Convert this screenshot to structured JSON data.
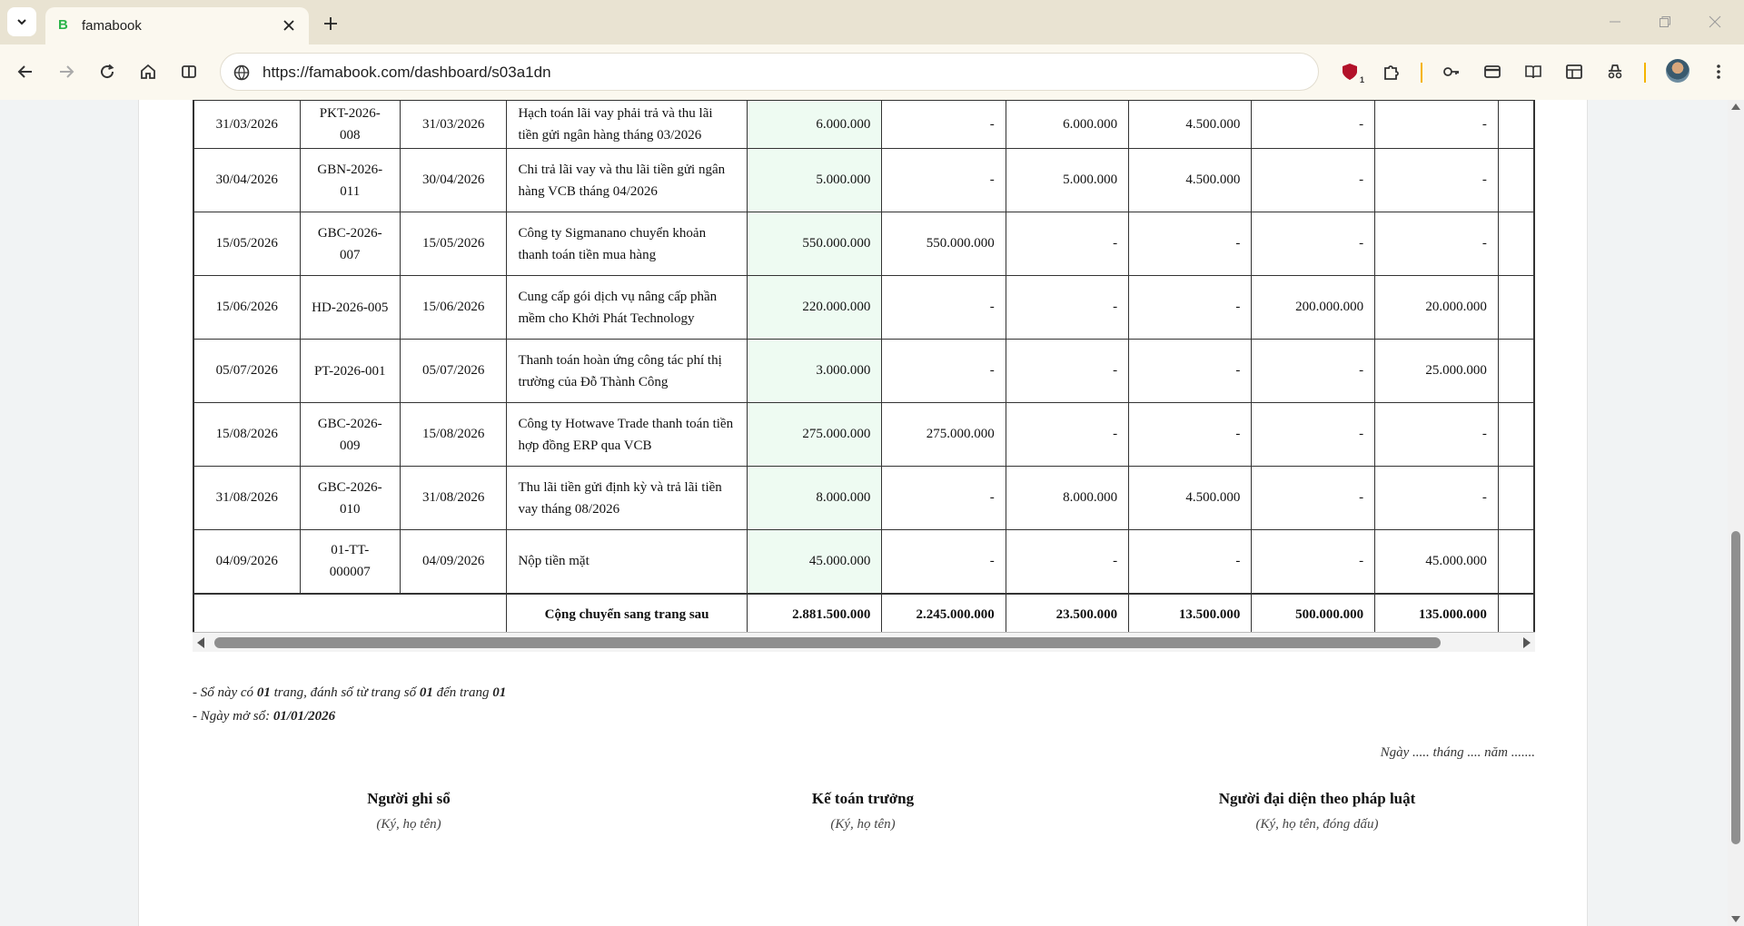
{
  "browser": {
    "tab_title": "famabook",
    "tab_favicon_letter": "B",
    "url": "https://famabook.com/dashboard/s03a1dn",
    "extension_badge": "1",
    "accent_color": "#f5b400"
  },
  "ledger": {
    "rows": [
      {
        "date": "31/03/2026",
        "doc_no": "PKT-2026-008",
        "doc_date": "31/03/2026",
        "desc": "Hạch toán lãi vay phải trả và thu lãi tiền gửi ngân hàng tháng 03/2026",
        "total": "6.000.000",
        "c1": "-",
        "c2": "6.000.000",
        "c3": "4.500.000",
        "c4": "-",
        "c5": "-"
      },
      {
        "date": "30/04/2026",
        "doc_no": "GBN-2026-011",
        "doc_date": "30/04/2026",
        "desc": "Chi trả lãi vay và thu lãi tiền gửi ngân hàng VCB tháng 04/2026",
        "total": "5.000.000",
        "c1": "-",
        "c2": "5.000.000",
        "c3": "4.500.000",
        "c4": "-",
        "c5": "-"
      },
      {
        "date": "15/05/2026",
        "doc_no": "GBC-2026-007",
        "doc_date": "15/05/2026",
        "desc": "Công ty Sigmanano chuyển khoản thanh toán tiền mua hàng",
        "total": "550.000.000",
        "c1": "550.000.000",
        "c2": "-",
        "c3": "-",
        "c4": "-",
        "c5": "-"
      },
      {
        "date": "15/06/2026",
        "doc_no": "HD-2026-005",
        "doc_date": "15/06/2026",
        "desc": "Cung cấp gói dịch vụ nâng cấp phần mềm cho Khởi Phát Technology",
        "total": "220.000.000",
        "c1": "-",
        "c2": "-",
        "c3": "-",
        "c4": "200.000.000",
        "c5": "20.000.000"
      },
      {
        "date": "05/07/2026",
        "doc_no": "PT-2026-001",
        "doc_date": "05/07/2026",
        "desc": "Thanh toán hoàn ứng công tác phí thị trường của Đỗ Thành Công",
        "total": "3.000.000",
        "c1": "-",
        "c2": "-",
        "c3": "-",
        "c4": "-",
        "c5": "25.000.000"
      },
      {
        "date": "15/08/2026",
        "doc_no": "GBC-2026-009",
        "doc_date": "15/08/2026",
        "desc": "Công ty Hotwave Trade thanh toán tiền hợp đồng ERP qua VCB",
        "total": "275.000.000",
        "c1": "275.000.000",
        "c2": "-",
        "c3": "-",
        "c4": "-",
        "c5": "-"
      },
      {
        "date": "31/08/2026",
        "doc_no": "GBC-2026-010",
        "doc_date": "31/08/2026",
        "desc": "Thu lãi tiền gửi định kỳ và trả lãi tiền vay tháng 08/2026",
        "total": "8.000.000",
        "c1": "-",
        "c2": "8.000.000",
        "c3": "4.500.000",
        "c4": "-",
        "c5": "-"
      },
      {
        "date": "04/09/2026",
        "doc_no": "01-TT-000007",
        "doc_date": "04/09/2026",
        "desc": "Nộp tiền mặt",
        "total": "45.000.000",
        "c1": "-",
        "c2": "-",
        "c3": "-",
        "c4": "-",
        "c5": "45.000.000"
      }
    ],
    "footer": {
      "label": "Cộng chuyển sang trang sau",
      "total": "2.881.500.000",
      "c1": "2.245.000.000",
      "c2": "23.500.000",
      "c3": "13.500.000",
      "c4": "500.000.000",
      "c5": "135.000.000"
    }
  },
  "notes": {
    "line1_a": "- Sổ này có ",
    "line1_pages": "01",
    "line1_b": " trang, đánh số từ trang số ",
    "line1_from": "01",
    "line1_c": " đến trang ",
    "line1_to": "01",
    "line2_a": "- Ngày mở sổ: ",
    "line2_date": "01/01/2026"
  },
  "date_line": "Ngày ..... tháng .... năm .......",
  "signatures": [
    {
      "title": "Người ghi sổ",
      "sub": "(Ký, họ tên)"
    },
    {
      "title": "Kế toán trưởng",
      "sub": "(Ký, họ tên)"
    },
    {
      "title": "Người đại diện theo pháp luật",
      "sub": "(Ký, họ tên, đóng dấu)"
    }
  ]
}
